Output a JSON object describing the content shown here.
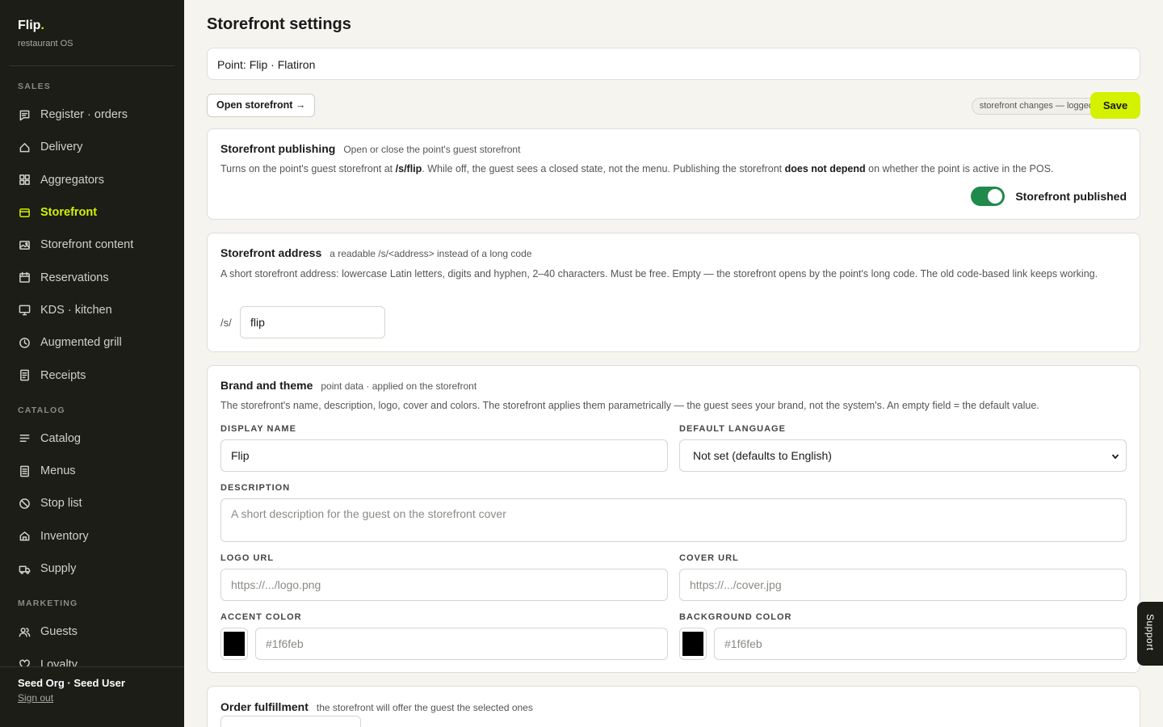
{
  "brand": {
    "name": "Flip",
    "dot": ".",
    "subtitle": "restaurant OS"
  },
  "nav": {
    "sections": [
      {
        "label": "SALES",
        "items": [
          {
            "label": "Register · orders",
            "icon": "receipt-chat-icon",
            "active": false
          },
          {
            "label": "Delivery",
            "icon": "delivery-icon",
            "active": false
          },
          {
            "label": "Aggregators",
            "icon": "grid-icon",
            "active": false
          },
          {
            "label": "Storefront",
            "icon": "storefront-icon",
            "active": true
          },
          {
            "label": "Storefront content",
            "icon": "image-icon",
            "active": false
          },
          {
            "label": "Reservations",
            "icon": "calendar-icon",
            "active": false
          },
          {
            "label": "KDS · kitchen",
            "icon": "monitor-icon",
            "active": false
          },
          {
            "label": "Augmented grill",
            "icon": "clock-icon",
            "active": false
          },
          {
            "label": "Receipts",
            "icon": "document-icon",
            "active": false
          }
        ]
      },
      {
        "label": "CATALOG",
        "items": [
          {
            "label": "Catalog",
            "icon": "list-icon",
            "active": false
          },
          {
            "label": "Menus",
            "icon": "menu-book-icon",
            "active": false
          },
          {
            "label": "Stop list",
            "icon": "ban-icon",
            "active": false
          },
          {
            "label": "Inventory",
            "icon": "home-icon",
            "active": false
          },
          {
            "label": "Supply",
            "icon": "truck-icon",
            "active": false
          }
        ]
      },
      {
        "label": "MARKETING",
        "items": [
          {
            "label": "Guests",
            "icon": "users-icon",
            "active": false
          },
          {
            "label": "Loyalty",
            "icon": "heart-icon",
            "active": false
          }
        ]
      }
    ]
  },
  "footer": {
    "user": "Seed Org · Seed User",
    "sign_out": "Sign out"
  },
  "page": {
    "title": "Storefront settings",
    "point": "Point: Flip · Flatiron",
    "open_storefront": "Open storefront →",
    "log_badge": "storefront changes — logged",
    "save": "Save"
  },
  "publishing": {
    "title": "Storefront publishing",
    "subtitle": "Open or close the point's guest storefront",
    "desc_1": "Turns on the point's guest storefront at ",
    "desc_path": "/s/flip",
    "desc_2": ". While off, the guest sees a closed state, not the menu. Publishing the storefront ",
    "desc_bold": "does not depend",
    "desc_3": " on whether the point is active in the POS.",
    "toggle_label": "Storefront published",
    "published": true
  },
  "address": {
    "title": "Storefront address",
    "subtitle": "a readable /s/<address> instead of a long code",
    "desc": "A short storefront address: lowercase Latin letters, digits and hyphen, 2–40 characters. Must be free. Empty — the storefront opens by the point's long code. The old code-based link keeps working.",
    "prefix": "/s/",
    "value": "flip"
  },
  "brand_theme": {
    "title": "Brand and theme",
    "subtitle": "point data · applied on the storefront",
    "desc": "The storefront's name, description, logo, cover and colors. The storefront applies them parametrically — the guest sees your brand, not the system's. An empty field = the default value.",
    "display_name_label": "DISPLAY NAME",
    "display_name_value": "Flip",
    "language_label": "DEFAULT LANGUAGE",
    "language_value": "Not set (defaults to English)",
    "description_label": "DESCRIPTION",
    "description_placeholder": "A short description for the guest on the storefront cover",
    "logo_label": "LOGO URL",
    "logo_placeholder": "https://.../logo.png",
    "cover_label": "COVER URL",
    "cover_placeholder": "https://.../cover.jpg",
    "accent_label": "ACCENT COLOR",
    "accent_placeholder": "#1f6feb",
    "background_label": "BACKGROUND COLOR",
    "background_placeholder": "#1f6feb",
    "accent_swatch": "#000000",
    "background_swatch": "#000000"
  },
  "fulfillment": {
    "title": "Order fulfillment",
    "subtitle": "the storefront will offer the guest the selected ones"
  },
  "support": "Support",
  "colors": {
    "sidebar_bg": "#1b1d16",
    "accent": "#d4f200",
    "toggle_on": "#1f8a4c",
    "page_bg": "#f5f4ef"
  }
}
